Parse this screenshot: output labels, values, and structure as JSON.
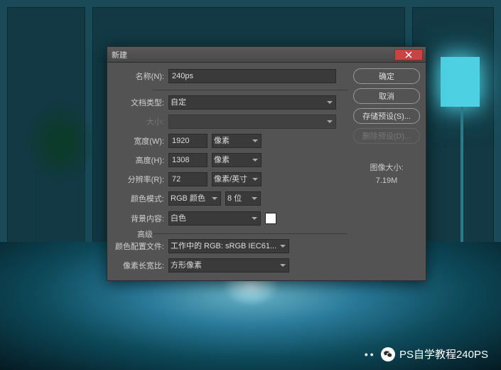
{
  "dialog": {
    "title": "新建",
    "buttons": {
      "ok": "确定",
      "cancel": "取消",
      "save_preset": "存储预设(S)...",
      "delete_preset": "删除预设(D)..."
    },
    "labels": {
      "name": "名称(N):",
      "doc_type": "文档类型:",
      "size": "大小:",
      "width": "宽度(W):",
      "height": "高度(H):",
      "resolution": "分辨率(R):",
      "color_mode": "颜色模式:",
      "bg_content": "背景内容:",
      "advanced": "高级",
      "color_profile": "颜色配置文件:",
      "pixel_ratio": "像素长宽比:",
      "image_size_label": "图像大小:"
    },
    "values": {
      "name": "240ps",
      "doc_type": "自定",
      "width": "1920",
      "width_unit": "像素",
      "height": "1308",
      "height_unit": "像素",
      "resolution": "72",
      "resolution_unit": "像素/英寸",
      "color_mode": "RGB 颜色",
      "bit_depth": "8 位",
      "bg_content": "白色",
      "color_profile": "工作中的 RGB: sRGB IEC61...",
      "pixel_ratio": "方形像素",
      "image_size": "7.19M"
    }
  },
  "footer": {
    "text": "PS自学教程240PS"
  }
}
